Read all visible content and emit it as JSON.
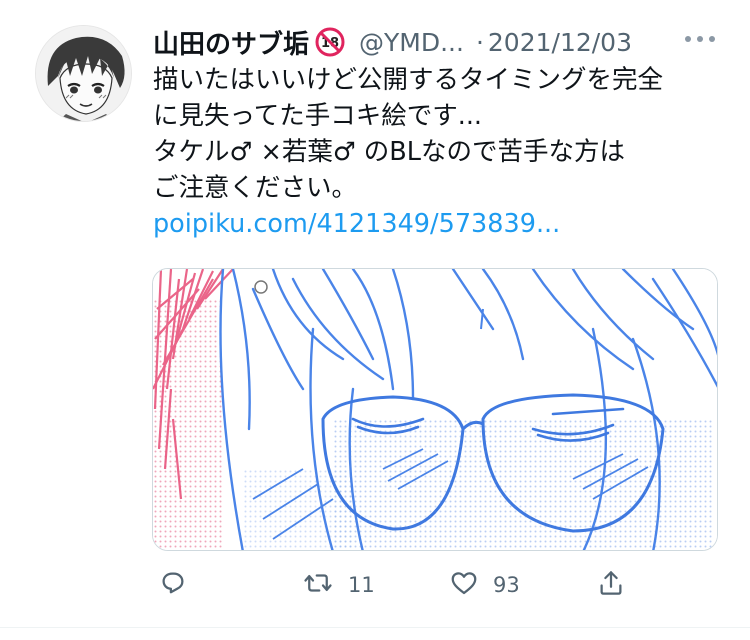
{
  "user": {
    "display_name": "山田のサブ垢",
    "badge": "no-under-18-icon",
    "handle": "@YMD...",
    "separator": "·",
    "date": "2021/12/03"
  },
  "tweet": {
    "lines": [
      "描いたはいいけど公開するタイミングを完全",
      "に見失ってた手コキ絵です...",
      "タケル♂ ×若葉♂ のBLなので苦手な方は",
      "ご注意ください。"
    ],
    "link": "poipiku.com/4121349/573839..."
  },
  "actions": {
    "reply": {
      "icon": "reply-icon"
    },
    "retweet": {
      "icon": "retweet-icon",
      "count": "11"
    },
    "like": {
      "icon": "heart-icon",
      "count": "93"
    },
    "share": {
      "icon": "share-icon"
    }
  },
  "colors": {
    "link": "#1d9bf0",
    "muted": "#536471",
    "sketch_blue": "#4a84e8",
    "sketch_pink": "#e8557d"
  }
}
